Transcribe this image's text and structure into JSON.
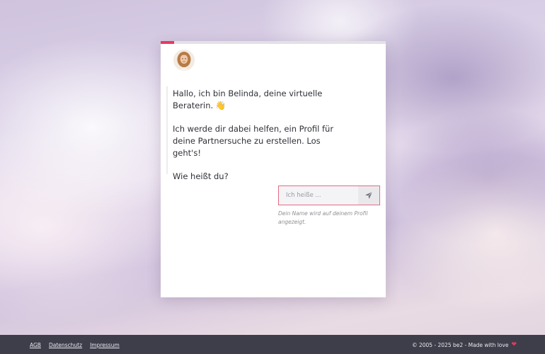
{
  "progress": {
    "percent": 6
  },
  "assistant": {
    "avatar_icon": "avatar-belinda",
    "messages": [
      "Hallo, ich bin Belinda, deine virtuelle Beraterin.",
      "Ich werde dir dabei helfen, ein Profil für deine Partnersuche zu erstellen. Los geht's!",
      "Wie heißt du?"
    ],
    "wave_emoji": "👋"
  },
  "name_input": {
    "placeholder": "Ich heiße ...",
    "value": "",
    "hint": "Dein Name wird auf deinem Profil angezeigt.",
    "send_icon": "paper-plane-icon"
  },
  "footer": {
    "links": [
      "AGB",
      "Datenschutz",
      "Impressum"
    ],
    "copyright": "© 2005 - 2025 be2 - Made with love",
    "heart_icon": "heart-icon"
  },
  "colors": {
    "accent": "#e8385e",
    "footer_bg": "#3d3e4a"
  }
}
